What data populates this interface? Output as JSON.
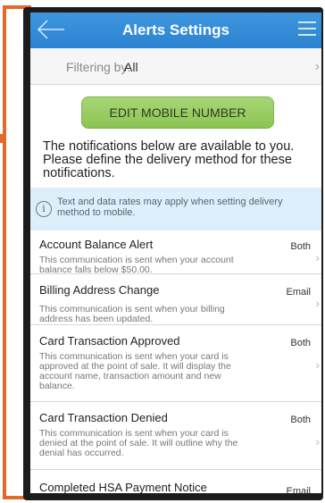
{
  "header": {
    "title": "Alerts Settings"
  },
  "filter": {
    "label": "Filtering by:",
    "value": "All"
  },
  "edit_button": {
    "label": "EDIT MOBILE NUMBER"
  },
  "intro_text": "The notifications below are available to you. Please define the delivery method for these notifications.",
  "info_banner": {
    "text": "Text and data rates may apply when setting delivery method to mobile."
  },
  "alerts": [
    {
      "title": "Account Balance Alert",
      "method": "Both",
      "description": "This communication is sent when your account balance falls below $50.00."
    },
    {
      "title": "Billing Address Change",
      "method": "Email",
      "description": "This communication is sent when your billing address has been updated."
    },
    {
      "title": "Card Transaction Approved",
      "method": "Both",
      "description": "This communication is sent when your card is approved at the point of sale.  It will display the account name, transaction amount and new balance."
    },
    {
      "title": "Card Transaction Denied",
      "method": "Both",
      "description": "This communication is sent when your card is denied at the point of sale.  It will outline why the denial has occurred."
    },
    {
      "title": "Completed HSA Payment Notice",
      "method": "Email",
      "description": ""
    }
  ],
  "colors": {
    "header": "#2b82d0",
    "button": "#8cc453",
    "annotation": "#e4692a",
    "banner": "#dceffb"
  }
}
